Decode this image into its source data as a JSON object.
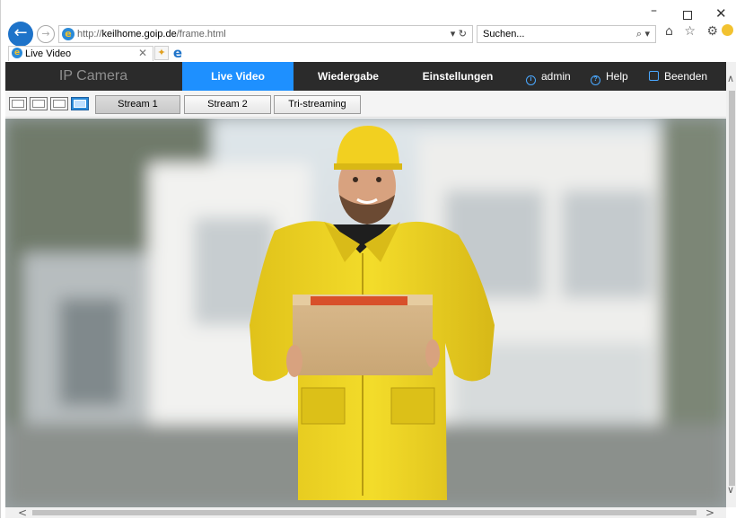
{
  "window_controls": {
    "minimize": "–",
    "maximize": "",
    "close": "✕"
  },
  "browser": {
    "url_prefix": "http://",
    "url_host": "keilhome.goip.de",
    "url_path": "/frame.html",
    "address_tools": "▾ ↻",
    "search_placeholder": "Suchen...",
    "search_icon": "⌕ ▾",
    "toolbar_icons": "⌂ ☆ ⚙",
    "tab_title": "Live Video",
    "tab_close": "✕",
    "icons": {
      "back": "back-arrow-icon",
      "forward": "forward-arrow-icon",
      "site": "internet-explorer-icon",
      "edge": "edge-icon"
    }
  },
  "camera_nav": {
    "brand": "IP Camera",
    "items": [
      {
        "label": "Live Video",
        "active": true
      },
      {
        "label": "Wiedergabe",
        "active": false
      },
      {
        "label": "Einstellungen",
        "active": false
      }
    ],
    "user": "admin",
    "help": "Help",
    "logout": "Beenden",
    "accent_color": "#1e90ff",
    "bar_color": "#2b2b2b"
  },
  "stream_bar": {
    "layout_modes": [
      "1x1",
      "2x2",
      "3x3",
      "fullscreen"
    ],
    "selected_layout": "fullscreen",
    "streams": [
      {
        "label": "Stream 1",
        "active": true
      },
      {
        "label": "Stream 2",
        "active": false
      },
      {
        "label": "Tri-streaming",
        "active": false
      }
    ]
  },
  "video": {
    "content": "camera-feed"
  },
  "scrollbars": {
    "up": "∧",
    "down": "∨",
    "left": "<",
    "right": ">"
  }
}
